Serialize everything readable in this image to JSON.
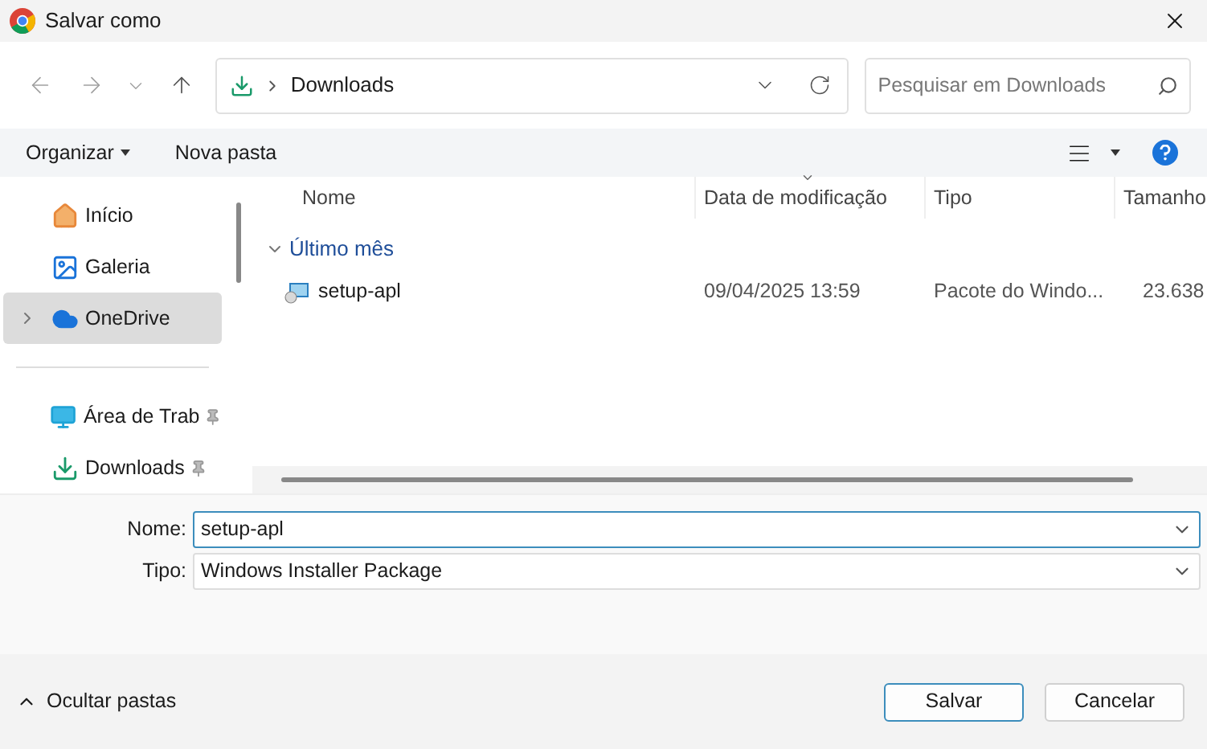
{
  "window": {
    "title": "Salvar como"
  },
  "address": {
    "location": "Downloads"
  },
  "search": {
    "placeholder": "Pesquisar em Downloads"
  },
  "toolbar": {
    "organize": "Organizar",
    "new_folder": "Nova pasta"
  },
  "sidebar": {
    "items": [
      {
        "kind": "home",
        "label": "Início",
        "selected": false,
        "pinned": false,
        "expandable": false
      },
      {
        "kind": "gallery",
        "label": "Galeria",
        "selected": false,
        "pinned": false,
        "expandable": false
      },
      {
        "kind": "cloud",
        "label": "OneDrive",
        "selected": true,
        "pinned": false,
        "expandable": true
      },
      {
        "kind": "desktop",
        "label": "Área de Trab",
        "selected": false,
        "pinned": true,
        "expandable": false
      },
      {
        "kind": "download",
        "label": "Downloads",
        "selected": false,
        "pinned": true,
        "expandable": false
      }
    ]
  },
  "table": {
    "columns": [
      "Nome",
      "Data de modificação",
      "Tipo",
      "Tamanho"
    ],
    "groups": [
      {
        "label": "Último mês",
        "expanded": true,
        "rows": [
          {
            "name": "setup-apl",
            "modified": "09/04/2025 13:59",
            "type": "Pacote do Windo...",
            "size": "23.638"
          }
        ]
      }
    ]
  },
  "form": {
    "name_label": "Nome:",
    "name_value": "setup-apl",
    "type_label": "Tipo:",
    "type_value": "Windows Installer Package"
  },
  "footer": {
    "toggle": "Ocultar pastas",
    "save": "Salvar",
    "cancel": "Cancelar"
  }
}
